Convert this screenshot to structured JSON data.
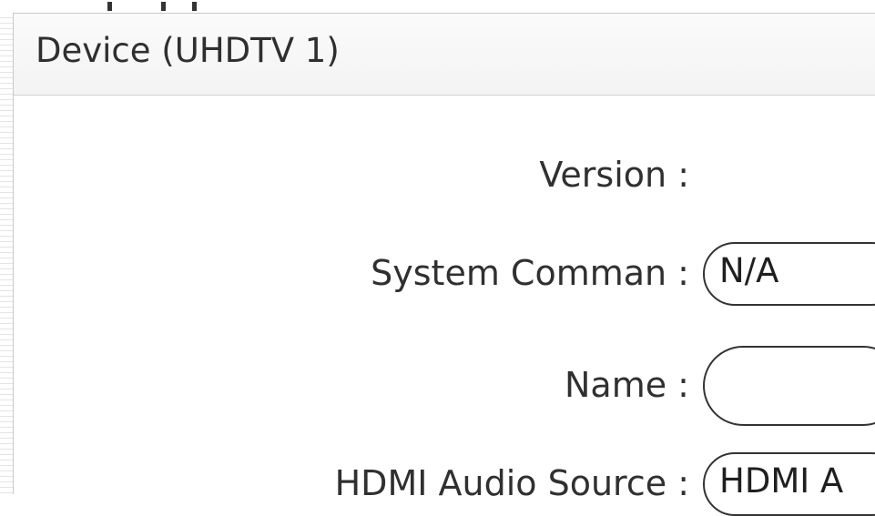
{
  "panel": {
    "title": "Device (UHDTV 1)"
  },
  "form": {
    "version": {
      "label": "Version :",
      "value": ""
    },
    "system_command": {
      "label": "System Comman :",
      "value": "N/A"
    },
    "name": {
      "label": "Name :",
      "value": ""
    },
    "hdmi_audio_source": {
      "label": "HDMI Audio Source :",
      "value": "HDMI A"
    }
  },
  "colors": {
    "border": "#333333",
    "header_bg": "#f3f3f3",
    "divider": "#cfcfcf",
    "text": "#2b2b2b"
  }
}
